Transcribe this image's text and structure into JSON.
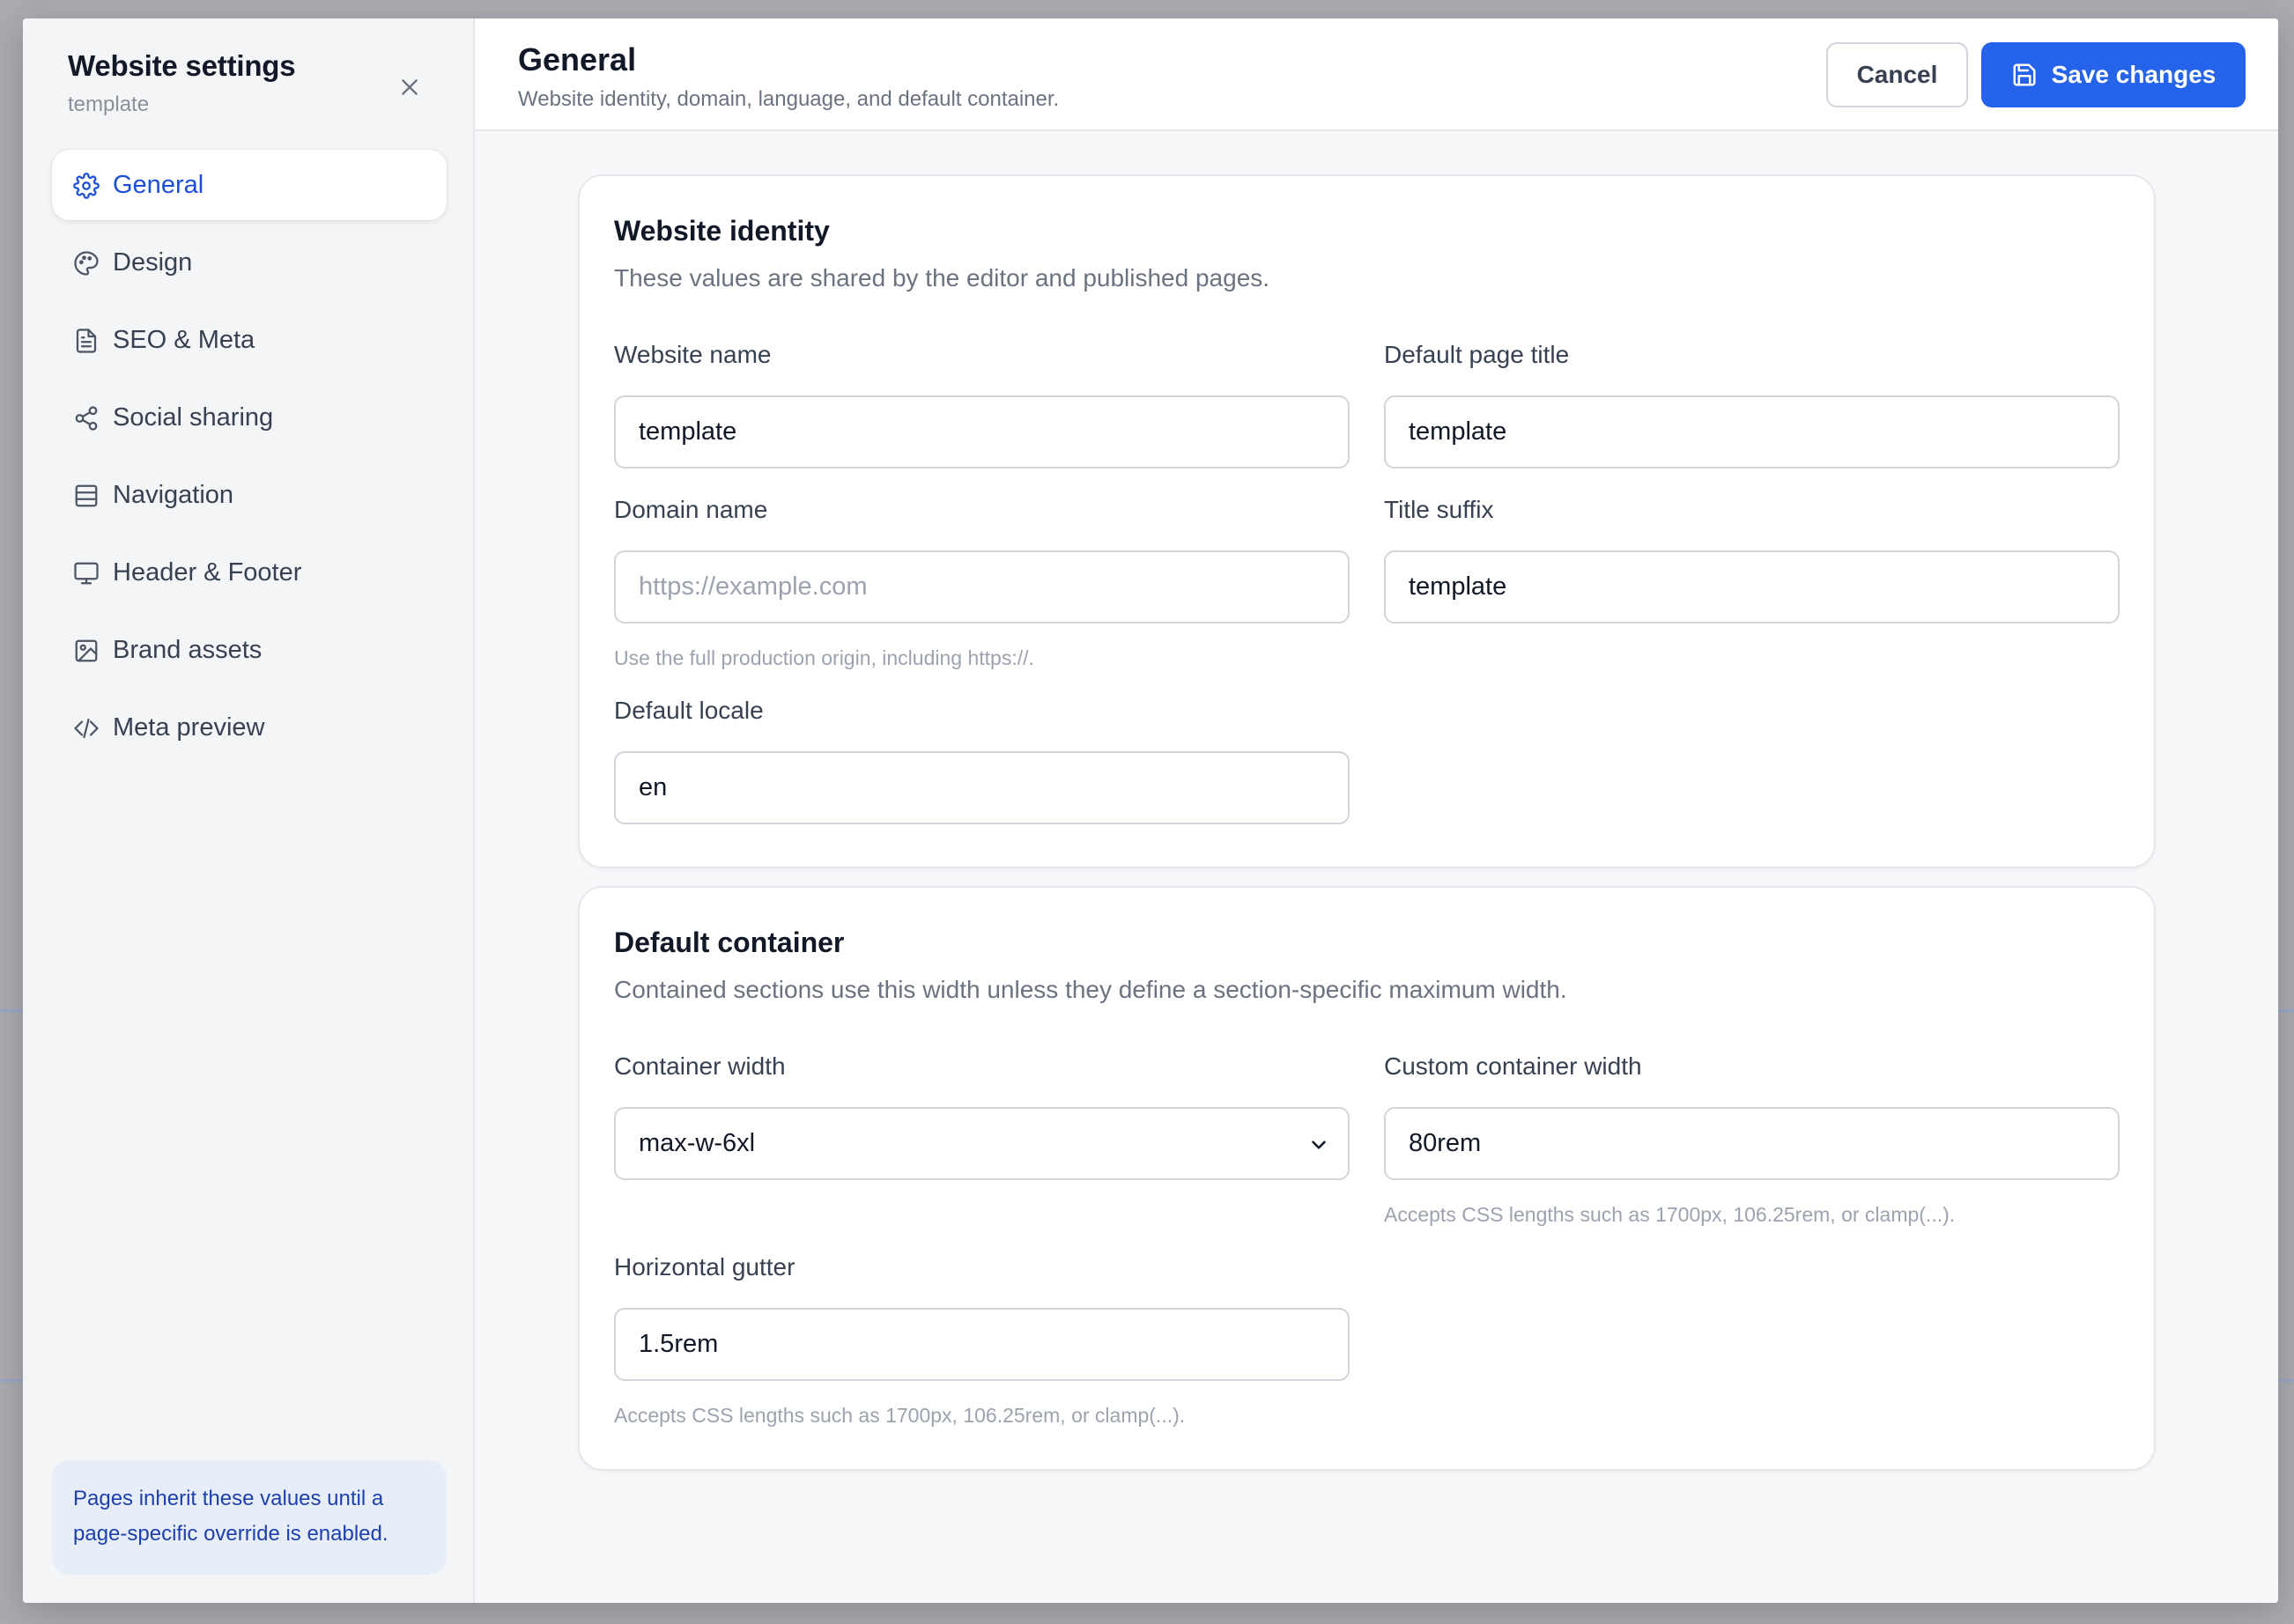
{
  "sidebar": {
    "title": "Website settings",
    "subtitle": "template",
    "items": [
      {
        "label": "General",
        "icon": "gear-icon",
        "active": true
      },
      {
        "label": "Design",
        "icon": "palette-icon"
      },
      {
        "label": "SEO & Meta",
        "icon": "file-text-icon"
      },
      {
        "label": "Social sharing",
        "icon": "share-icon"
      },
      {
        "label": "Navigation",
        "icon": "navigation-icon"
      },
      {
        "label": "Header & Footer",
        "icon": "monitor-icon"
      },
      {
        "label": "Brand assets",
        "icon": "image-icon"
      },
      {
        "label": "Meta preview",
        "icon": "code-icon"
      }
    ],
    "note": "Pages inherit these values until a page-specific override is enabled."
  },
  "header": {
    "title": "General",
    "subtitle": "Website identity, domain, language, and default container.",
    "cancel_label": "Cancel",
    "save_label": "Save changes"
  },
  "identity": {
    "title": "Website identity",
    "description": "These values are shared by the editor and published pages.",
    "website_name": {
      "label": "Website name",
      "value": "template"
    },
    "default_page_title": {
      "label": "Default page title",
      "value": "template"
    },
    "domain_name": {
      "label": "Domain name",
      "value": "",
      "placeholder": "https://example.com",
      "hint": "Use the full production origin, including https://."
    },
    "title_suffix": {
      "label": "Title suffix",
      "value": "template"
    },
    "default_locale": {
      "label": "Default locale",
      "value": "en"
    }
  },
  "container": {
    "title": "Default container",
    "description": "Contained sections use this width unless they define a section-specific maximum width.",
    "container_width": {
      "label": "Container width",
      "value": "max-w-6xl"
    },
    "custom_width": {
      "label": "Custom container width",
      "value": "80rem",
      "hint": "Accepts CSS lengths such as 1700px, 106.25rem, or clamp(...)."
    },
    "gutter": {
      "label": "Horizontal gutter",
      "value": "1.5rem",
      "hint": "Accepts CSS lengths such as 1700px, 106.25rem, or clamp(...)."
    }
  },
  "colors": {
    "accent": "#2563eb",
    "active_nav": "#1d4ed8",
    "note_bg": "#e8eef8"
  }
}
